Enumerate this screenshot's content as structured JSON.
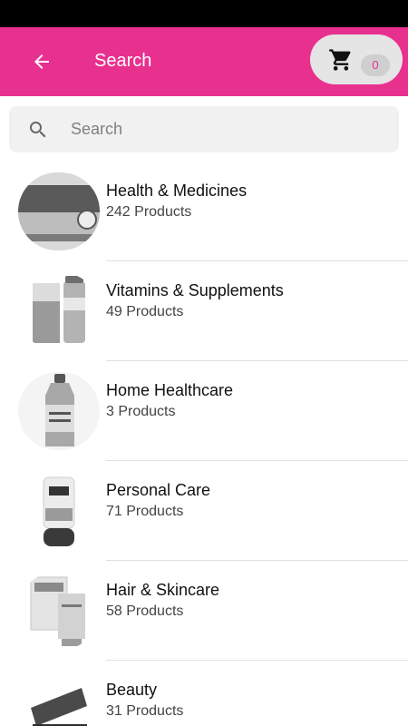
{
  "header": {
    "title": "Search",
    "back_icon": "arrow-left-icon",
    "cart_icon": "shopping-cart-icon",
    "cart_count": "0"
  },
  "search": {
    "placeholder": "Search",
    "value": ""
  },
  "categories": [
    {
      "name": "Health & Medicines",
      "count": "242 Products"
    },
    {
      "name": "Vitamins & Supplements",
      "count": "49 Products"
    },
    {
      "name": "Home Healthcare",
      "count": "3 Products"
    },
    {
      "name": "Personal Care",
      "count": "71 Products"
    },
    {
      "name": "Hair & Skincare",
      "count": "58 Products"
    },
    {
      "name": "Beauty",
      "count": "31 Products"
    }
  ],
  "colors": {
    "brand": "#e8308f",
    "cart_pill": "#e5e5e5",
    "search_bg": "#f1f1f1"
  }
}
